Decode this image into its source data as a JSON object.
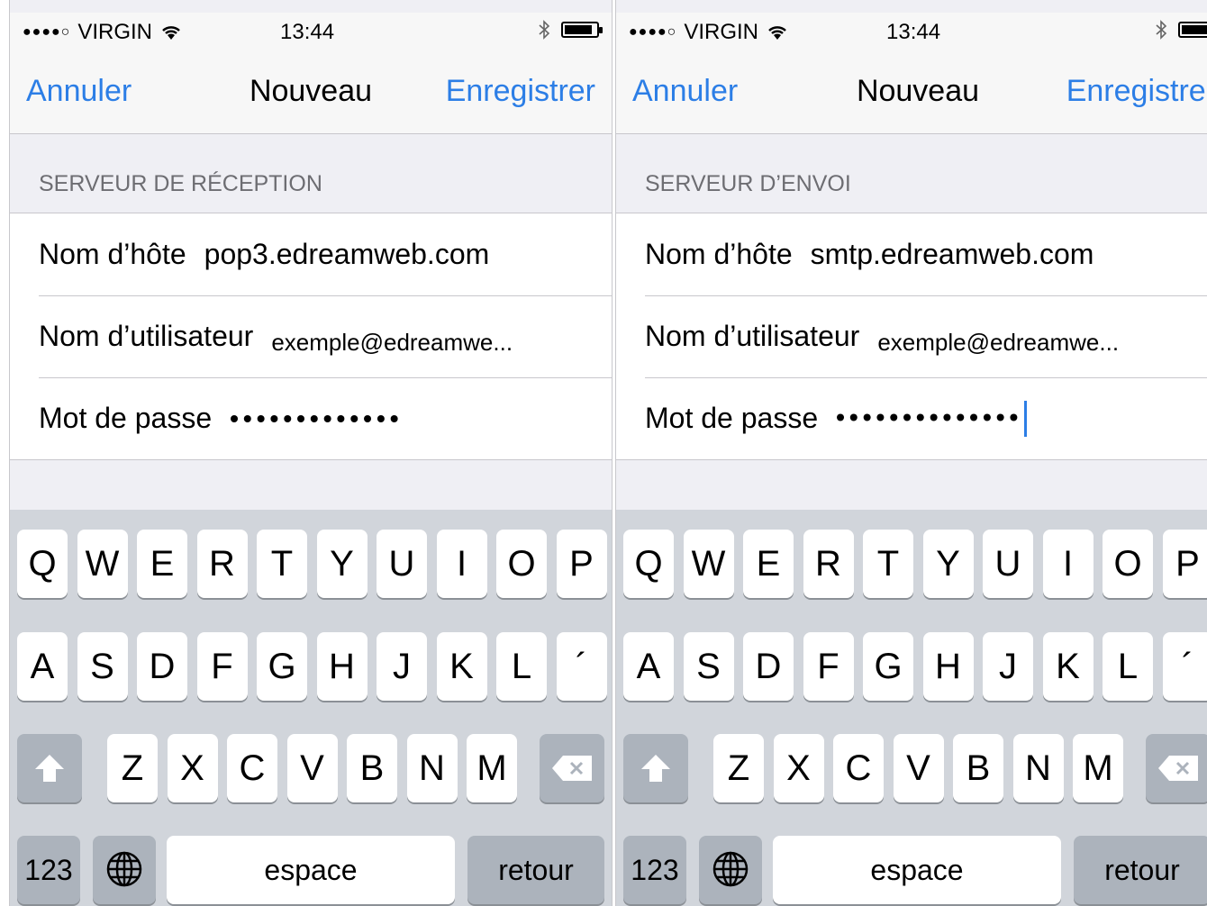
{
  "screens": [
    {
      "status": {
        "carrier": "VIRGIN",
        "time": "13:44"
      },
      "nav": {
        "cancel": "Annuler",
        "title": "Nouveau",
        "save": "Enregistrer"
      },
      "section_header": "SERVEUR DE RÉCEPTION",
      "rows": [
        {
          "label": "Nom d’hôte",
          "value": "pop3.edreamweb.com"
        },
        {
          "label": "Nom d’utilisateur",
          "value": "exemple@edreamwe..."
        },
        {
          "label": "Mot de passe",
          "value": "•••••••••••••"
        }
      ],
      "caret": false
    },
    {
      "status": {
        "carrier": "VIRGIN",
        "time": "13:44"
      },
      "nav": {
        "cancel": "Annuler",
        "title": "Nouveau",
        "save": "Enregistrer"
      },
      "section_header": "SERVEUR D’ENVOI",
      "rows": [
        {
          "label": "Nom d’hôte",
          "value": "smtp.edreamweb.com"
        },
        {
          "label": "Nom d’utilisateur",
          "value": "exemple@edreamwe..."
        },
        {
          "label": "Mot de passe",
          "value": "••••••••••••••"
        }
      ],
      "caret": true
    }
  ],
  "keyboard": {
    "row1": [
      "Q",
      "W",
      "E",
      "R",
      "T",
      "Y",
      "U",
      "I",
      "O",
      "P"
    ],
    "row2": [
      "A",
      "S",
      "D",
      "F",
      "G",
      "H",
      "J",
      "K",
      "L",
      "´"
    ],
    "row3": [
      "Z",
      "X",
      "C",
      "V",
      "B",
      "N",
      "M"
    ],
    "numbers_key": "123",
    "space_key": "espace",
    "return_key": "retour"
  },
  "colors": {
    "accent": "#2c7ee6",
    "keyboard_bg": "#d1d5db",
    "function_key": "#acb3bc"
  },
  "icons": [
    "signal-dots-icon",
    "wifi-icon",
    "bluetooth-icon",
    "battery-icon",
    "shift-icon",
    "globe-icon",
    "backspace-icon"
  ]
}
